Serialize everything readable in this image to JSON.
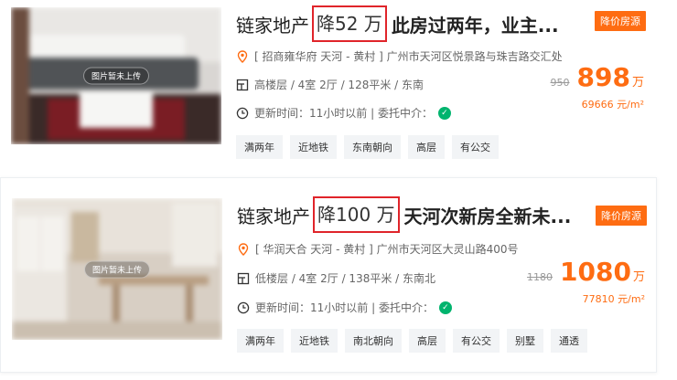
{
  "listings": [
    {
      "brand": "链家地产",
      "price_drop": "降52 万",
      "title_desc": "此房过两年，业主...",
      "badge": "降价房源",
      "image_overlay": "图片暂未上传",
      "address": "[ 招商雍华府 天河 - 黄村 ] 广州市天河区悦景路与珠吉路交汇处",
      "details": "高楼层 / 4室 2厅 / 128平米 / 东南",
      "update": "更新时间：11小时以前 | 委托中介：",
      "old_price": "950",
      "price": "898",
      "price_unit": "万",
      "unit_price": "69666 元/m²",
      "tags": [
        "满两年",
        "近地铁",
        "东南朝向",
        "高层",
        "有公交"
      ]
    },
    {
      "brand": "链家地产",
      "price_drop": "降100 万",
      "title_desc": "天河次新房全新未...",
      "badge": "降价房源",
      "image_overlay": "图片暂未上传",
      "address": "[ 华润天合 天河 - 黄村 ] 广州市天河区大灵山路400号",
      "details": "低楼层 / 4室 2厅 / 138平米 / 东南北",
      "update": "更新时间：11小时以前 | 委托中介：",
      "old_price": "1180",
      "price": "1080",
      "price_unit": "万",
      "unit_price": "77810 元/m²",
      "tags": [
        "满两年",
        "近地铁",
        "南北朝向",
        "高层",
        "有公交",
        "别墅",
        "通透"
      ]
    }
  ],
  "colors": {
    "accent": "#fe6c12",
    "highlight_border": "#e0242a",
    "verified": "#00b46e"
  },
  "icons": [
    "location-icon",
    "layout-icon",
    "clock-icon",
    "verified-icon"
  ]
}
